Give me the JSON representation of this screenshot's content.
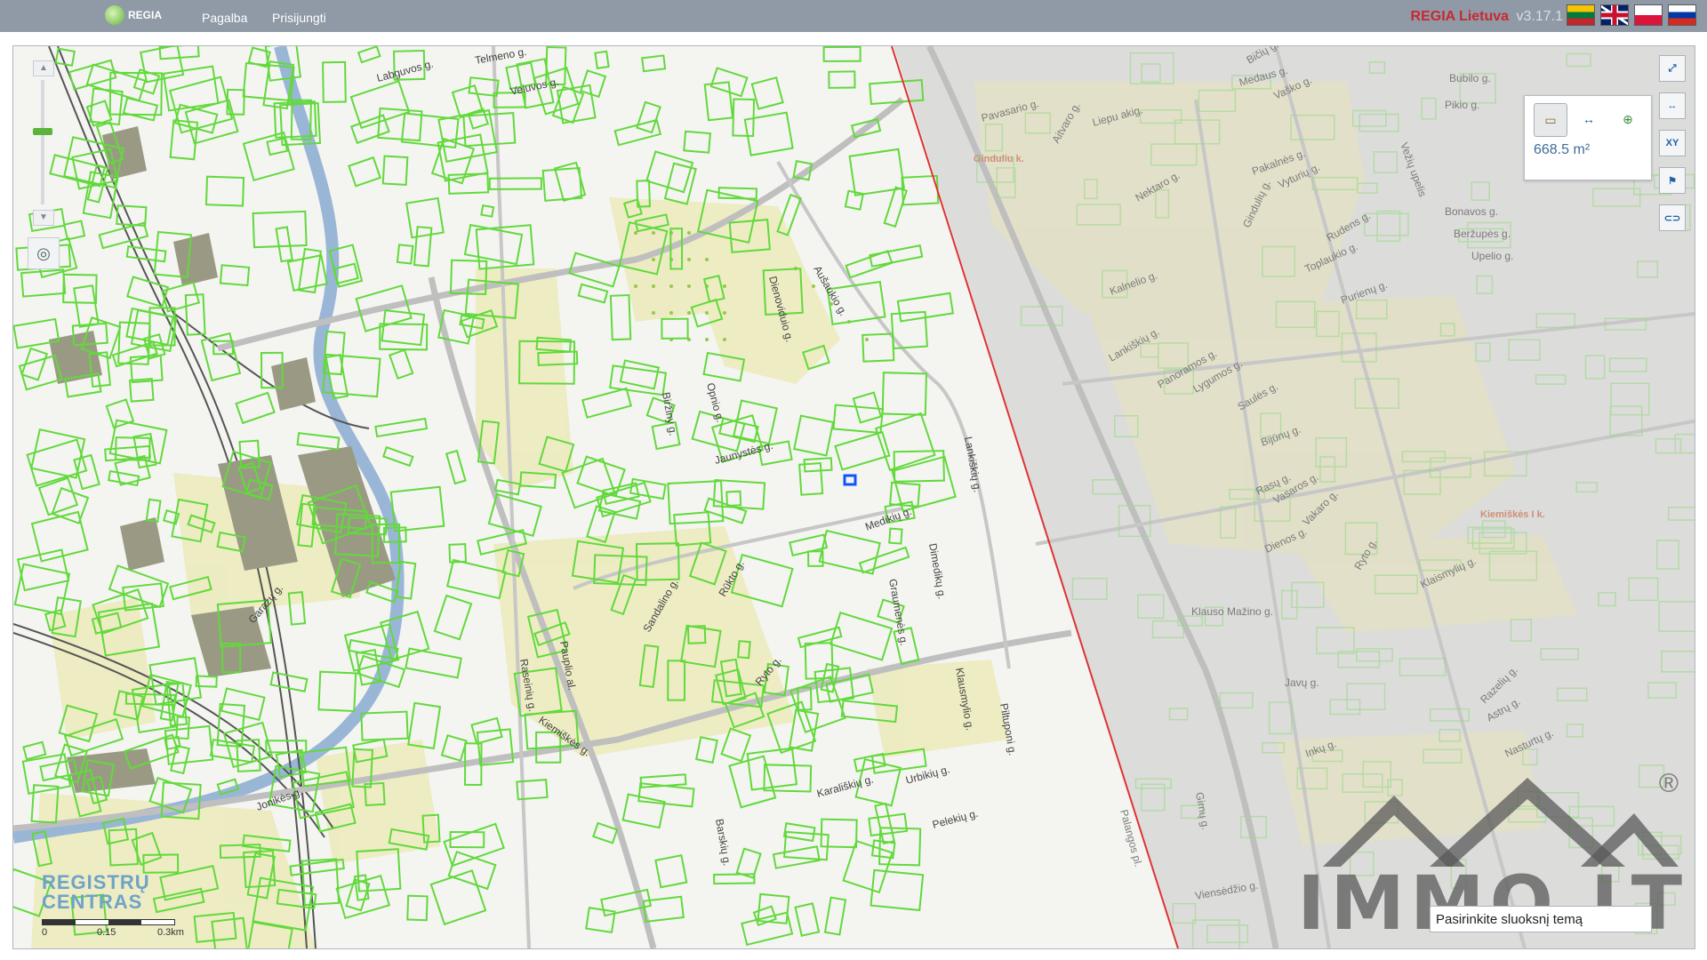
{
  "topbar": {
    "logo_text": "REGIA",
    "nav": [
      "Pagalba",
      "Prisijungti"
    ],
    "brand_name": "REGIA Lietuva",
    "version": "v3.17.1",
    "flags": [
      "lt",
      "en",
      "pl",
      "ru"
    ]
  },
  "map": {
    "zoom_in_label": "▲",
    "zoom_out_label": "▼",
    "locate_icon": "◎",
    "tools": [
      {
        "name": "fullscreen-icon",
        "glyph": "⤢"
      },
      {
        "name": "measure-icon",
        "glyph": "↔"
      },
      {
        "name": "xy-icon",
        "glyph": "XY"
      },
      {
        "name": "flag-icon",
        "glyph": "⚑"
      },
      {
        "name": "link-icon",
        "glyph": "⊂⊃"
      }
    ],
    "measure_panel": {
      "area_value": "668.5 m²"
    },
    "streets_left": [
      "Labguvos g.",
      "Veiuvos g.",
      "Telmeno g.",
      "Dienoviduio g.",
      "Aušaukio g.",
      "Biržiny g.",
      "Opnio g.",
      "Jaunystės g.",
      "Lankiškių g.",
      "Medikių g.",
      "Graumenės g.",
      "Dimedikų g.",
      "Raseinių g.",
      "Pauplio al.",
      "Kiemiškės g.",
      "Sandalino g.",
      "Rūkto g.",
      "Ryto g.",
      "Karališkių g.",
      "Urbikių g.",
      "Pelekių g.",
      "Barskių g.",
      "Jonikės g.",
      "Klausmylio g.",
      "Piltuponi g.",
      "Garažų g."
    ],
    "streets_right": [
      "Pavasario g.",
      "Liepu akig.",
      "Medaus g.",
      "Bubilo g.",
      "Pikio g.",
      "Vaško g.",
      "Bičių g.",
      "Ginduliu k.",
      "Aitvaro g.",
      "Pakalnės g.",
      "Vyturių g.",
      "Nektaro g.",
      "Gindulių g.",
      "Rudens g.",
      "Bonavos g.",
      "Beržupės g.",
      "Upelio g.",
      "Kalnelio g.",
      "Toplaukio g.",
      "Purienų g.",
      "Lankiškių g.",
      "Panoramos g.",
      "Lygumos g.",
      "Saulės g.",
      "Bijūnų g.",
      "Rasų g.",
      "Vasaros g.",
      "Dienos g.",
      "Vakaro g.",
      "Ryto g.",
      "Klaismylių g.",
      "Klauso Mažino g.",
      "Javų g.",
      "Inkų g.",
      "Razelių g.",
      "Astrų g.",
      "Nasturtų g.",
      "Kiemiškės I k.",
      "Girnų g.",
      "Viensėdžio g.",
      "Palangos pl.",
      "Vežių upelis"
    ],
    "rc_logo": [
      "REGISTRŲ",
      "CENTRAS"
    ],
    "scale_labels": [
      "0",
      "0.15",
      "0.3km"
    ]
  },
  "watermark": {
    "text": "IMMO.LT",
    "reg": "®"
  },
  "theme_input": {
    "value": "Pasirinkite sluoksnį temą"
  }
}
